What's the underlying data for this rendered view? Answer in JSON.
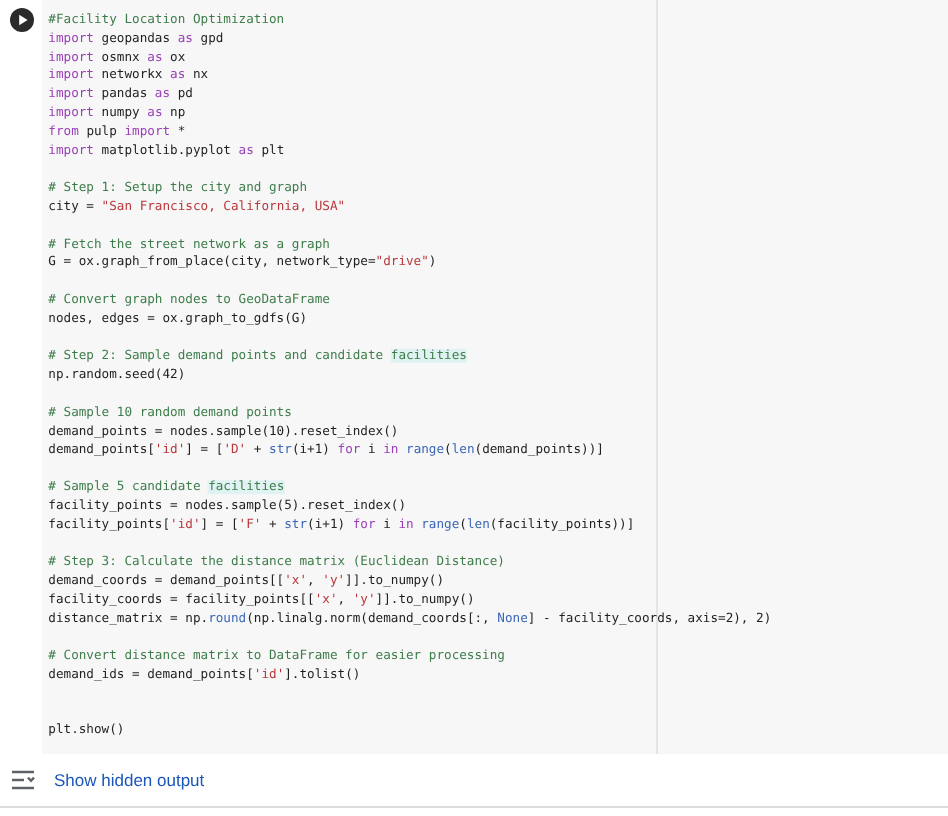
{
  "cell": {
    "lines": [
      {
        "kind": "code",
        "tokens": [
          {
            "text": "#Facility Location Optimization",
            "kind": "comment"
          }
        ]
      },
      {
        "kind": "code",
        "tokens": [
          {
            "text": "import",
            "kind": "keyword"
          },
          {
            "text": " geopandas ",
            "kind": "plain"
          },
          {
            "text": "as",
            "kind": "keyword"
          },
          {
            "text": " gpd",
            "kind": "plain"
          }
        ]
      },
      {
        "kind": "code",
        "tokens": [
          {
            "text": "import",
            "kind": "keyword"
          },
          {
            "text": " osmnx ",
            "kind": "plain"
          },
          {
            "text": "as",
            "kind": "keyword"
          },
          {
            "text": " ox",
            "kind": "plain"
          }
        ]
      },
      {
        "kind": "code",
        "tokens": [
          {
            "text": "import",
            "kind": "keyword"
          },
          {
            "text": " networkx ",
            "kind": "plain"
          },
          {
            "text": "as",
            "kind": "keyword"
          },
          {
            "text": " nx",
            "kind": "plain"
          }
        ]
      },
      {
        "kind": "code",
        "tokens": [
          {
            "text": "import",
            "kind": "keyword"
          },
          {
            "text": " pandas ",
            "kind": "plain"
          },
          {
            "text": "as",
            "kind": "keyword"
          },
          {
            "text": " pd",
            "kind": "plain"
          }
        ]
      },
      {
        "kind": "code",
        "tokens": [
          {
            "text": "import",
            "kind": "keyword"
          },
          {
            "text": " numpy ",
            "kind": "plain"
          },
          {
            "text": "as",
            "kind": "keyword"
          },
          {
            "text": " np",
            "kind": "plain"
          }
        ]
      },
      {
        "kind": "code",
        "tokens": [
          {
            "text": "from",
            "kind": "keyword"
          },
          {
            "text": " pulp ",
            "kind": "plain"
          },
          {
            "text": "import",
            "kind": "keyword"
          },
          {
            "text": " *",
            "kind": "plain"
          }
        ]
      },
      {
        "kind": "code",
        "tokens": [
          {
            "text": "import",
            "kind": "keyword"
          },
          {
            "text": " matplotlib.pyplot ",
            "kind": "plain"
          },
          {
            "text": "as",
            "kind": "keyword"
          },
          {
            "text": " plt",
            "kind": "plain"
          }
        ]
      },
      {
        "kind": "blank"
      },
      {
        "kind": "code",
        "tokens": [
          {
            "text": "# Step 1: Setup the city and graph",
            "kind": "comment"
          }
        ]
      },
      {
        "kind": "code",
        "tokens": [
          {
            "text": "city = ",
            "kind": "plain"
          },
          {
            "text": "\"San Francisco, California, USA\"",
            "kind": "string"
          }
        ]
      },
      {
        "kind": "blank"
      },
      {
        "kind": "code",
        "tokens": [
          {
            "text": "# Fetch the street network as a graph",
            "kind": "comment"
          }
        ]
      },
      {
        "kind": "code",
        "tokens": [
          {
            "text": "G = ox.graph_from_place(city, network_type=",
            "kind": "plain"
          },
          {
            "text": "\"drive\"",
            "kind": "string"
          },
          {
            "text": ")",
            "kind": "plain"
          }
        ]
      },
      {
        "kind": "blank"
      },
      {
        "kind": "code",
        "tokens": [
          {
            "text": "# Convert graph nodes to GeoDataFrame",
            "kind": "comment"
          }
        ]
      },
      {
        "kind": "code",
        "tokens": [
          {
            "text": "nodes, edges = ox.graph_to_gdfs(G)",
            "kind": "plain"
          }
        ]
      },
      {
        "kind": "blank"
      },
      {
        "kind": "code",
        "tokens": [
          {
            "text": "# Step 2: Sample demand points and candidate ",
            "kind": "comment"
          },
          {
            "text": "facilities",
            "kind": "match"
          }
        ]
      },
      {
        "kind": "code",
        "tokens": [
          {
            "text": "np.random.seed(42)",
            "kind": "plain"
          }
        ]
      },
      {
        "kind": "blank"
      },
      {
        "kind": "code",
        "tokens": [
          {
            "text": "# Sample 10 random demand points",
            "kind": "comment"
          }
        ]
      },
      {
        "kind": "code",
        "tokens": [
          {
            "text": "demand_points = nodes.sample(10).reset_index()",
            "kind": "plain"
          }
        ]
      },
      {
        "kind": "code",
        "tokens": [
          {
            "text": "demand_points[",
            "kind": "plain"
          },
          {
            "text": "'id'",
            "kind": "string"
          },
          {
            "text": "] = [",
            "kind": "plain"
          },
          {
            "text": "'D'",
            "kind": "string"
          },
          {
            "text": " + ",
            "kind": "plain"
          },
          {
            "text": "str",
            "kind": "builtin"
          },
          {
            "text": "(i+1) ",
            "kind": "plain"
          },
          {
            "text": "for",
            "kind": "keyword"
          },
          {
            "text": " i ",
            "kind": "plain"
          },
          {
            "text": "in ",
            "kind": "keyword"
          },
          {
            "text": "range",
            "kind": "builtin"
          },
          {
            "text": "(",
            "kind": "plain"
          },
          {
            "text": "len",
            "kind": "builtin"
          },
          {
            "text": "(demand_points))]",
            "kind": "plain"
          }
        ]
      },
      {
        "kind": "blank"
      },
      {
        "kind": "code",
        "tokens": [
          {
            "text": "# Sample 5 candidate ",
            "kind": "comment"
          },
          {
            "text": "facilities",
            "kind": "match"
          }
        ]
      },
      {
        "kind": "code",
        "tokens": [
          {
            "text": "facility_points = nodes.sample(5).reset_index()",
            "kind": "plain"
          }
        ]
      },
      {
        "kind": "code",
        "tokens": [
          {
            "text": "facility_points[",
            "kind": "plain"
          },
          {
            "text": "'id'",
            "kind": "string"
          },
          {
            "text": "] = [",
            "kind": "plain"
          },
          {
            "text": "'F'",
            "kind": "string"
          },
          {
            "text": " + ",
            "kind": "plain"
          },
          {
            "text": "str",
            "kind": "builtin"
          },
          {
            "text": "(i+1) ",
            "kind": "plain"
          },
          {
            "text": "for",
            "kind": "keyword"
          },
          {
            "text": " i ",
            "kind": "plain"
          },
          {
            "text": "in ",
            "kind": "keyword"
          },
          {
            "text": "range",
            "kind": "builtin"
          },
          {
            "text": "(",
            "kind": "plain"
          },
          {
            "text": "len",
            "kind": "builtin"
          },
          {
            "text": "(facility_points))]",
            "kind": "plain"
          }
        ]
      },
      {
        "kind": "blank"
      },
      {
        "kind": "code",
        "tokens": [
          {
            "text": "# Step 3: Calculate the distance matrix (Euclidean Distance)",
            "kind": "comment"
          }
        ]
      },
      {
        "kind": "code",
        "tokens": [
          {
            "text": "demand_coords = demand_points[[",
            "kind": "plain"
          },
          {
            "text": "'x'",
            "kind": "string"
          },
          {
            "text": ", ",
            "kind": "plain"
          },
          {
            "text": "'y'",
            "kind": "string"
          },
          {
            "text": "]].to_numpy()",
            "kind": "plain"
          }
        ]
      },
      {
        "kind": "code",
        "tokens": [
          {
            "text": "facility_coords = facility_points[[",
            "kind": "plain"
          },
          {
            "text": "'x'",
            "kind": "string"
          },
          {
            "text": ", ",
            "kind": "plain"
          },
          {
            "text": "'y'",
            "kind": "string"
          },
          {
            "text": "]].to_numpy()",
            "kind": "plain"
          }
        ]
      },
      {
        "kind": "code",
        "tokens": [
          {
            "text": "distance_matrix = np.",
            "kind": "plain"
          },
          {
            "text": "round",
            "kind": "builtin"
          },
          {
            "text": "(np.linalg.norm(demand_coords[:, ",
            "kind": "plain"
          },
          {
            "text": "None",
            "kind": "builtin"
          },
          {
            "text": "] - facility_coords, axis=2), 2)",
            "kind": "plain"
          }
        ]
      },
      {
        "kind": "blank"
      },
      {
        "kind": "code",
        "tokens": [
          {
            "text": "# Convert distance matrix to DataFrame for easier processing",
            "kind": "comment"
          }
        ]
      },
      {
        "kind": "code",
        "tokens": [
          {
            "text": "demand_ids = demand_points[",
            "kind": "plain"
          },
          {
            "text": "'id'",
            "kind": "string"
          },
          {
            "text": "].tolist()",
            "kind": "plain"
          }
        ]
      },
      {
        "kind": "blank"
      },
      {
        "kind": "blank"
      },
      {
        "kind": "code",
        "tokens": [
          {
            "text": "plt.show()",
            "kind": "plain"
          }
        ]
      }
    ]
  },
  "output": {
    "link": "Show hidden output"
  }
}
